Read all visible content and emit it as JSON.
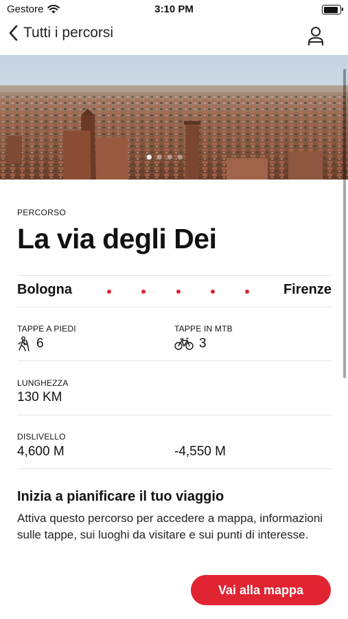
{
  "status_bar": {
    "carrier": "Gestore",
    "time": "3:10 PM"
  },
  "nav": {
    "back_label": "Tutti i percorsi"
  },
  "hero": {
    "total_pages": 4,
    "active_page": 1
  },
  "route": {
    "eyebrow": "PERCORSO",
    "title": "La via degli Dei",
    "start": "Bologna",
    "end": "Firenze",
    "accent_color": "#e02431"
  },
  "stats": {
    "walk_label": "TAPPE A PIEDI",
    "walk_value": "6",
    "mtb_label": "TAPPE IN MTB",
    "mtb_value": "3",
    "length_label": "LUNGHEZZA",
    "length_value": "130 KM",
    "elevation_label": "DISLIVELLO",
    "elevation_up": "4,600 M",
    "elevation_down": "-4,550 M"
  },
  "plan": {
    "heading": "Inizia a pianificare il tuo viaggio",
    "text": "Attiva questo percorso per accedere a mappa, informazioni sulle tappe, sui luoghi da visitare e sui punti di interesse."
  },
  "cta": {
    "label": "Vai alla mappa"
  },
  "icons": {
    "wifi": "wifi-icon",
    "back": "chevron-left-icon",
    "profile": "user-icon",
    "walk": "hiker-icon",
    "mtb": "bicycle-icon"
  }
}
